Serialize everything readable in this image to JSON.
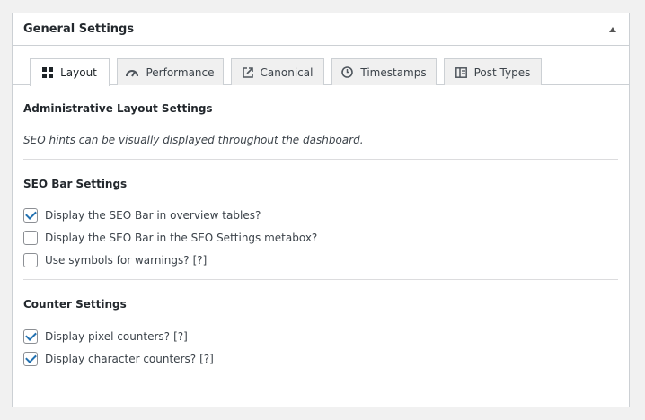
{
  "panel": {
    "title": "General Settings",
    "toggle_icon": "triangle-up-icon"
  },
  "tabs": [
    {
      "label": "Layout",
      "icon": "grid-icon",
      "active": true
    },
    {
      "label": "Performance",
      "icon": "dashboard-icon",
      "active": false
    },
    {
      "label": "Canonical",
      "icon": "external-link-icon",
      "active": false
    },
    {
      "label": "Timestamps",
      "icon": "clock-icon",
      "active": false
    },
    {
      "label": "Post Types",
      "icon": "layout-icon",
      "active": false
    }
  ],
  "layout_section": {
    "title": "Administrative Layout Settings",
    "description": "SEO hints can be visually displayed throughout the dashboard."
  },
  "seo_bar": {
    "title": "SEO Bar Settings",
    "options": [
      {
        "label": "Display the SEO Bar in overview tables?",
        "checked": true,
        "help": ""
      },
      {
        "label": "Display the SEO Bar in the SEO Settings metabox?",
        "checked": false,
        "help": ""
      },
      {
        "label": "Use symbols for warnings?",
        "checked": false,
        "help": "[?]"
      }
    ]
  },
  "counters": {
    "title": "Counter Settings",
    "options": [
      {
        "label": "Display pixel counters?",
        "checked": true,
        "help": "[?]"
      },
      {
        "label": "Display character counters?",
        "checked": true,
        "help": "[?]"
      }
    ]
  },
  "colors": {
    "accent": "#2271b1",
    "border": "#ccd0d4",
    "background": "#f1f1f1"
  }
}
